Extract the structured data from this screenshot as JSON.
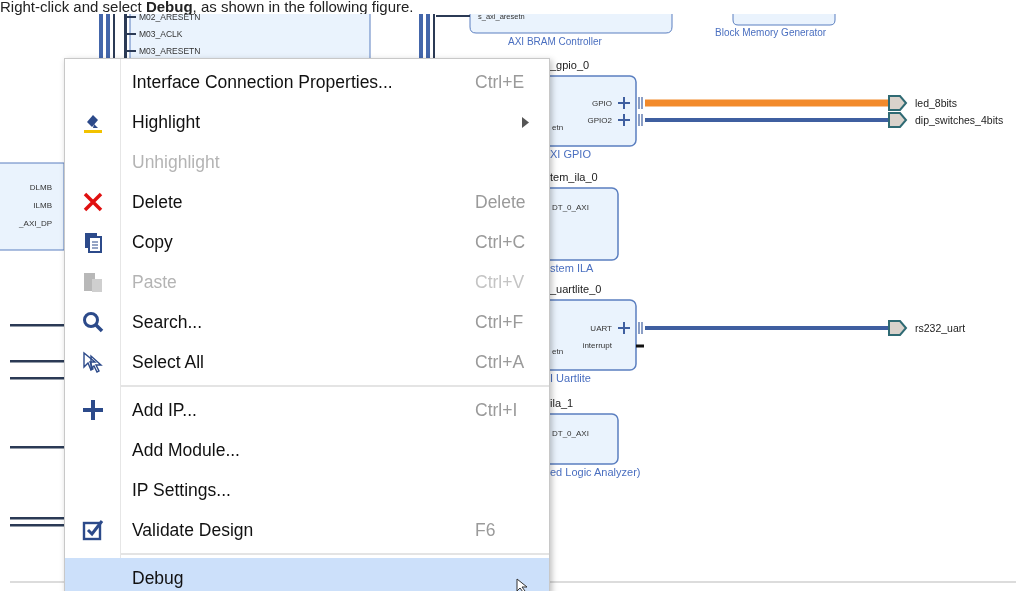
{
  "instruction": "Right-click and select **Debug**, as shown in the following figure.",
  "diagram": {
    "interconnect_ports": [
      "M02_ARESETN",
      "M03_ACLK",
      "M03_ARESETN"
    ],
    "bram_controller": {
      "port": "s_axi_aresetn",
      "label": "AXI BRAM Controller"
    },
    "block_memory": {
      "label": "Block Memory Generator"
    },
    "microblaze_ports": [
      "DLMB",
      "ILMB",
      "_AXI_DP"
    ],
    "blocks": [
      {
        "title": "_gpio_0",
        "left_port": "etn",
        "label": "XI GPIO",
        "ports": [
          {
            "name": "GPIO",
            "kind": "interface",
            "net": "led_8bits",
            "highlighted": true
          },
          {
            "name": "GPIO2",
            "kind": "interface",
            "net": "dip_switches_4bits",
            "highlighted": false
          }
        ]
      },
      {
        "title": "tem_ila_0",
        "left_port": "DT_0_AXI",
        "label": "stem ILA"
      },
      {
        "title": "_uartlite_0",
        "left_port": "etn",
        "label": "I Uartlite",
        "ports": [
          {
            "name": "UART",
            "kind": "interface",
            "net": "rs232_uart",
            "highlighted": false
          },
          {
            "name": "interrupt",
            "kind": "signal"
          }
        ]
      },
      {
        "title": "ila_1",
        "left_port": "DT_0_AXI",
        "label": "ed Logic Analyzer)"
      }
    ]
  },
  "menu": {
    "groups": [
      [
        {
          "label": "Interface Connection Properties...",
          "shortcut": "Ctrl+E",
          "disabled": false,
          "selected": false,
          "submenu": false
        },
        {
          "label": "Highlight",
          "disabled": false,
          "selected": false,
          "submenu": true
        },
        {
          "label": "Unhighlight",
          "disabled": true,
          "selected": false,
          "submenu": false
        },
        {
          "label": "Delete",
          "shortcut": "Delete",
          "disabled": false,
          "selected": false,
          "submenu": false
        },
        {
          "label": "Copy",
          "shortcut": "Ctrl+C",
          "disabled": false,
          "selected": false,
          "submenu": false
        },
        {
          "label": "Paste",
          "shortcut": "Ctrl+V",
          "disabled": true,
          "selected": false,
          "submenu": false
        },
        {
          "label": "Search...",
          "shortcut": "Ctrl+F",
          "disabled": false,
          "selected": false,
          "submenu": false
        },
        {
          "label": "Select All",
          "shortcut": "Ctrl+A",
          "disabled": false,
          "selected": false,
          "submenu": false
        }
      ],
      [
        {
          "label": "Add IP...",
          "shortcut": "Ctrl+I",
          "disabled": false,
          "selected": false,
          "submenu": false
        },
        {
          "label": "Add Module...",
          "disabled": false,
          "selected": false,
          "submenu": false
        },
        {
          "label": "IP Settings...",
          "disabled": false,
          "selected": false,
          "submenu": false
        },
        {
          "label": "Validate Design",
          "shortcut": "F6",
          "disabled": false,
          "selected": false,
          "submenu": false
        }
      ],
      [
        {
          "label": "Debug",
          "disabled": false,
          "selected": true,
          "submenu": false
        }
      ]
    ]
  }
}
